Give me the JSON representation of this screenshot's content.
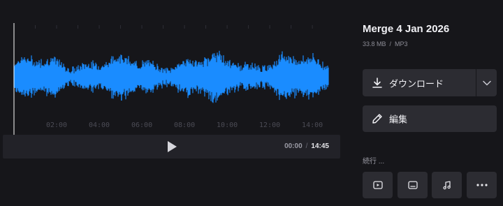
{
  "player": {
    "time_ticks": [
      "02:00",
      "04:00",
      "06:00",
      "08:00",
      "10:00",
      "12:00",
      "14:00"
    ],
    "current_time": "00:00",
    "separator": "/",
    "total_time": "14:45",
    "play_icon": "play-icon"
  },
  "waveform": {
    "color": "#1a8cff",
    "playhead_color": "#ffffff"
  },
  "file": {
    "title": "Merge 4 Jan 2026",
    "size": "33.8 MB",
    "meta_separator": "/",
    "format": "MP3"
  },
  "actions": {
    "download_label": "ダウンロード",
    "edit_label": "編集",
    "continue_label": "続行 ...",
    "continue_buttons": [
      "video-icon",
      "subtitle-icon",
      "music-icon",
      "more-icon"
    ]
  }
}
